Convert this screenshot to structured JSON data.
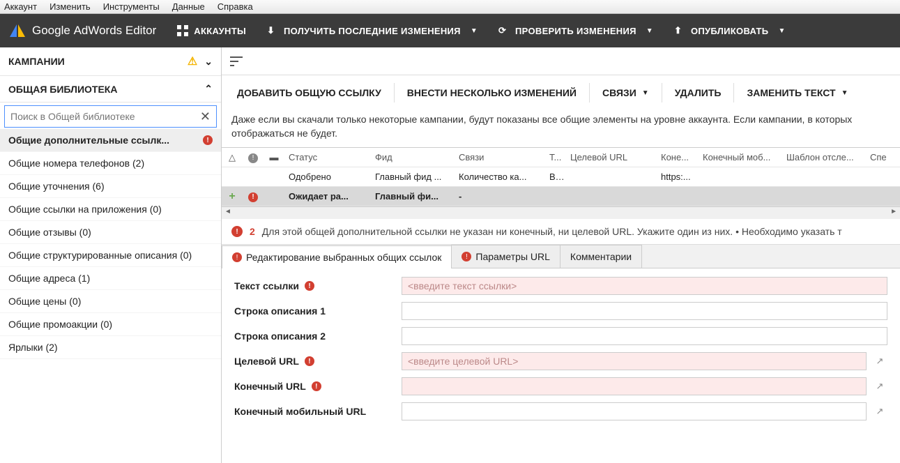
{
  "menu": {
    "items": [
      "Аккаунт",
      "Изменить",
      "Инструменты",
      "Данные",
      "Справка"
    ]
  },
  "toolbar": {
    "brand1": "Google",
    "brand2": "AdWords Editor",
    "accounts": "АККАУНТЫ",
    "get": "ПОЛУЧИТЬ ПОСЛЕДНИЕ ИЗМЕНЕНИЯ",
    "check": "ПРОВЕРИТЬ ИЗМЕНЕНИЯ",
    "publish": "ОПУБЛИКОВАТЬ"
  },
  "sidebar": {
    "campaigns": "КАМПАНИИ",
    "library": "ОБЩАЯ БИБЛИОТЕКА",
    "search_ph": "Поиск в Общей библиотеке",
    "items": [
      {
        "label": "Общие дополнительные ссылк...",
        "active": true,
        "err": true
      },
      {
        "label": "Общие номера телефонов (2)"
      },
      {
        "label": "Общие уточнения (6)"
      },
      {
        "label": "Общие ссылки на приложения (0)"
      },
      {
        "label": "Общие отзывы (0)"
      },
      {
        "label": "Общие структурированные описания (0)"
      },
      {
        "label": "Общие адреса (1)"
      },
      {
        "label": "Общие цены (0)"
      },
      {
        "label": "Общие промоакции (0)"
      },
      {
        "label": "Ярлыки (2)"
      }
    ]
  },
  "actions": {
    "add": "ДОБАВИТЬ ОБЩУЮ ССЫЛКУ",
    "bulk": "ВНЕСТИ НЕСКОЛЬКО ИЗМЕНЕНИЙ",
    "links": "СВЯЗИ",
    "delete": "УДАЛИТЬ",
    "replace": "ЗАМЕНИТЬ ТЕКСТ"
  },
  "info": "Даже если вы скачали только некоторые кампании, будут показаны все общие элементы на уровне аккаунта. Если кампании, в которых отображаться не будет.",
  "grid": {
    "headers": [
      "△",
      "",
      "",
      "Статус",
      "Фид",
      "Связи",
      "Т...",
      "Целевой URL",
      "Коне...",
      "Конечный моб...",
      "Шаблон отсле...",
      "Спе"
    ],
    "rows": [
      {
        "sel": false,
        "status": "Одобрено",
        "feed": "Главный фид ...",
        "links": "Количество ка...",
        "t": "Bl...",
        "dest": "",
        "final": "https:..."
      },
      {
        "sel": true,
        "add": true,
        "err": true,
        "status": "Ожидает ра...",
        "feed": "Главный фи...",
        "links": "-",
        "t": "",
        "dest": "",
        "final": ""
      }
    ]
  },
  "error": {
    "count": "2",
    "text": "Для этой общей дополнительной ссылки не указан ни конечный, ни целевой URL. Укажите один из них. • Необходимо указать т"
  },
  "tabs": {
    "t1": "Редактирование выбранных общих ссылок",
    "t2": "Параметры URL",
    "t3": "Комментарии"
  },
  "form": {
    "link_text": "Текст ссылки",
    "link_text_ph": "<введите текст ссылки>",
    "desc1": "Строка описания 1",
    "desc2": "Строка описания 2",
    "dest": "Целевой URL",
    "dest_ph": "<введите целевой URL>",
    "final": "Конечный URL",
    "final_mob": "Конечный мобильный URL"
  }
}
